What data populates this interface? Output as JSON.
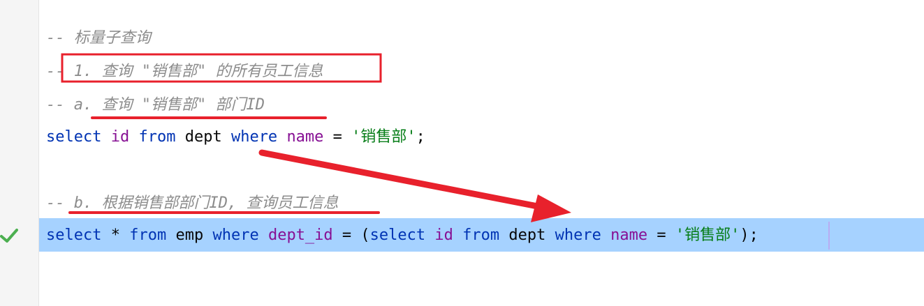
{
  "gutter": {
    "status_icon": "check-icon",
    "status_color": "#4caf50"
  },
  "lines": {
    "c1": "-- 标量子查询",
    "c2_prefix": "--",
    "c2_text": " 1. 查询 \"销售部\" 的所有员工信息",
    "c3": "-- a. 查询 \"销售部\" 部门ID",
    "q1": {
      "select": "select",
      "id": "id",
      "from": "from",
      "dept": "dept",
      "where": "where",
      "name": "name",
      "eq": "=",
      "value": "'销售部'",
      "semi": ";"
    },
    "c4": "-- b. 根据销售部部门ID, 查询员工信息",
    "q2": {
      "select": "select",
      "star": "*",
      "from": "from",
      "emp": "emp",
      "where": "where",
      "dept_id": "dept_id",
      "eq": "=",
      "lparen": "(",
      "select2": "select",
      "id": "id",
      "from2": "from",
      "dept": "dept",
      "where2": "where",
      "name": "name",
      "eq2": "=",
      "value": "'销售部'",
      "rparen": ")",
      "semi": ";"
    }
  },
  "colors": {
    "keyword": "#0033b3",
    "identifier": "#871094",
    "string": "#067d17",
    "comment": "#8c8c8c",
    "selection": "#a6d2ff",
    "annotation": "#e8212c"
  }
}
